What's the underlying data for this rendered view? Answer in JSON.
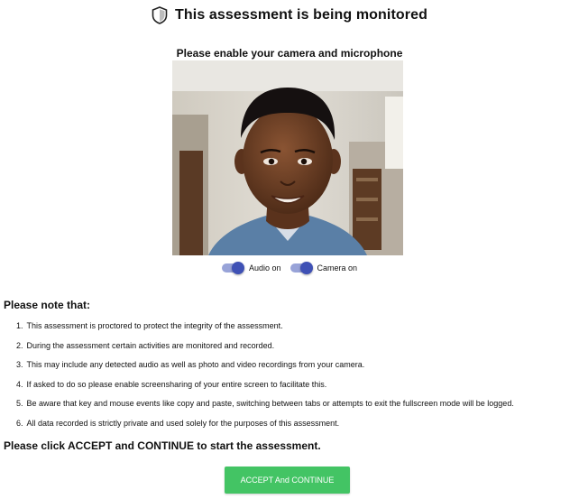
{
  "header": {
    "title": "This assessment is being monitored",
    "icon": "shield-icon"
  },
  "camera": {
    "title": "Please enable your camera and microphone",
    "video_description": "webcam-preview"
  },
  "toggles": {
    "audio_label": "Audio on",
    "audio_on": true,
    "camera_label": "Camera on",
    "camera_on": true,
    "accent_color": "#3f51b5"
  },
  "notes": {
    "heading": "Please note that:",
    "items": [
      {
        "num": "1.",
        "text": "This assessment is proctored to protect the integrity of the assessment."
      },
      {
        "num": "2.",
        "text": "During the assessment certain activities are monitored and recorded."
      },
      {
        "num": "3.",
        "text": "This may include any detected audio as well as photo and video recordings from your camera."
      },
      {
        "num": "4.",
        "text": "If asked to do so please enable screensharing of your entire screen to facilitate this."
      },
      {
        "num": "5.",
        "text": "Be aware that key and mouse events like copy and paste, switching between tabs or attempts to exit the fullscreen mode will be logged."
      },
      {
        "num": "6.",
        "text": "All data recorded is strictly private and used solely for the purposes of this assessment."
      }
    ]
  },
  "cta": {
    "text": "Please click ACCEPT and CONTINUE to start the assessment.",
    "button_label": "ACCEPT And CONTINUE",
    "button_color": "#43c464"
  }
}
